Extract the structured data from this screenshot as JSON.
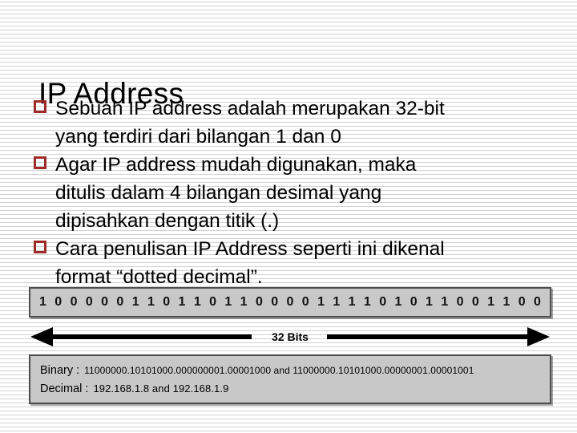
{
  "slide": {
    "title": "IP Address",
    "bullets": [
      {
        "marker": "square-bullet",
        "text": "Sebuah IP address adalah merupakan  32-bit\nyang terdiri dari bilangan  1 dan 0"
      },
      {
        "marker": "square-bullet",
        "text": "Agar IP address mudah digunakan, maka\nditulis dalam 4 bilangan desimal yang\ndipisahkan dengan titik (.)"
      },
      {
        "marker": "square-bullet",
        "text": "Cara penulisan  IP Address seperti ini dikenal\nformat  “dotted decimal”."
      }
    ],
    "bullet_color": "#9e2a2a"
  },
  "diagram": {
    "bits": [
      "1",
      "0",
      "0",
      "0",
      "0",
      "0",
      "1",
      "1",
      "0",
      "1",
      "1",
      "0",
      "1",
      "1",
      "0",
      "0",
      "0",
      "0",
      "1",
      "1",
      "1",
      "1",
      "0",
      "1",
      "0",
      "1",
      "1",
      "0",
      "0",
      "1",
      "1",
      "0",
      "0"
    ],
    "arrow_label": "32 Bits",
    "info": [
      {
        "label": "Binary :",
        "value": "11000000.10101000.000000001.00001000 and 11000000.10101000.00000001.00001001"
      },
      {
        "label": "Decimal :",
        "value": "192.168.1.8 and 192.168.1.9"
      }
    ],
    "box_fill": "#c8c8c8",
    "box_border": "#4d4d4d"
  }
}
